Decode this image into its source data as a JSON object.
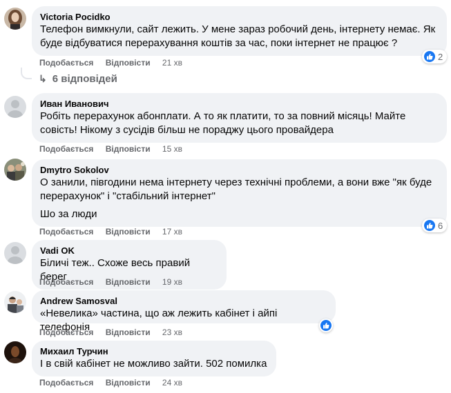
{
  "colors": {
    "like_blue": "#1877f2",
    "bubble_bg": "#f0f2f5",
    "meta_gray": "#65676b"
  },
  "comments": [
    {
      "author": "Victoria Pocidko",
      "text": "Телефон вимкнули, сайт лежить. У мене зараз робочий день, інтернету немає. Як буде відбуватися перерахування коштів за час, поки інтернет не працює ?",
      "like": "Подобається",
      "reply": "Відповісти",
      "time": "21 хв",
      "reaction_icon": "like-icon",
      "reaction_count": "2",
      "replies_label": "6 відповідей"
    },
    {
      "author": "Иван Иванович",
      "text": "Робіть перерахунок абонплати. А то як платити, то за повний місяць! Майте совість! Нікому з сусідів більш не пораджу цього провайдера",
      "like": "Подобається",
      "reply": "Відповісти",
      "time": "15 хв"
    },
    {
      "author": "Dmytro Sokolov",
      "text": "О занили, півгодини нема інтернету через технічні проблеми, а вони вже \"як буде перерахунок\" і \"стабільний інтернет\"",
      "text2": "Шо за люди",
      "like": "Подобається",
      "reply": "Відповісти",
      "time": "17 хв",
      "reaction_icon": "like-icon",
      "reaction_count": "6"
    },
    {
      "author": "Vadi OK",
      "text": "Біличі теж.. Схоже весь правий берег",
      "like": "Подобається",
      "reply": "Відповісти",
      "time": "19 хв"
    },
    {
      "author": "Andrew Samosval",
      "text": "«Невелика» частина, що аж лежить кабінет і айпі телефонія",
      "like": "Подобається",
      "reply": "Відповісти",
      "time": "23 хв",
      "reaction_icon": "like-icon"
    },
    {
      "author": "Михаил Турчин",
      "text": "І в свій кабінет не можливо зайти. 502 помилка",
      "like": "Подобається",
      "reply": "Відповісти",
      "time": "24 хв"
    }
  ]
}
